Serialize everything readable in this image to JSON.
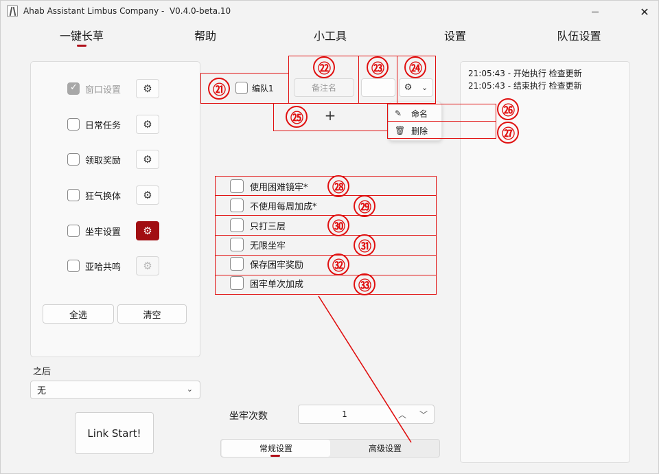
{
  "window": {
    "title": "Ahab Assistant Limbus Company -  V0.4.0-beta.10",
    "minimize_glyph": "—",
    "close_glyph": "✕"
  },
  "nav": {
    "tabs": [
      {
        "label": "一键长草",
        "active": true
      },
      {
        "label": "帮助"
      },
      {
        "label": "小工具"
      },
      {
        "label": "设置"
      },
      {
        "label": "队伍设置"
      }
    ]
  },
  "tasks": {
    "items": [
      {
        "label": "窗口设置",
        "checked": true,
        "disabled": true
      },
      {
        "label": "日常任务"
      },
      {
        "label": "领取奖励"
      },
      {
        "label": "狂气换体"
      },
      {
        "label": "坐牢设置",
        "settings_active": true
      },
      {
        "label": "亚哈共鸣",
        "settings_disabled": true
      }
    ],
    "select_all": "全选",
    "clear": "清空"
  },
  "after": {
    "label": "之后",
    "value": "无"
  },
  "link_start": "Link Start!",
  "team": {
    "checkbox_label": "编队1",
    "remark_placeholder": "备注名",
    "add_glyph": "+",
    "menu": {
      "rename": "命名",
      "delete": "删除"
    }
  },
  "options": [
    "使用困难镜牢*",
    "不使用每周加成*",
    "只打三层",
    "无限坐牢",
    "保存困牢奖励",
    "困牢单次加成"
  ],
  "prison_count": {
    "label": "坐牢次数",
    "value": "1"
  },
  "settings_tabs": {
    "normal": "常规设置",
    "advanced": "高级设置"
  },
  "log": [
    "21:05:43 - 开始执行 检查更新",
    "21:05:43 - 结束执行 检查更新"
  ],
  "annotations": [
    "㉑",
    "㉒",
    "㉓",
    "㉔",
    "㉕",
    "㉖",
    "㉗",
    "㉘",
    "㉙",
    "㉚",
    "㉛",
    "㉜",
    "㉝"
  ],
  "colors": {
    "accent": "#b0101a",
    "annotation_red": "#e01010",
    "active_settings_button": "#a10e12"
  }
}
